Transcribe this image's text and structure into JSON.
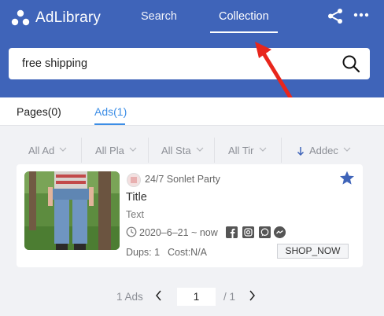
{
  "app": {
    "name": "AdLibrary"
  },
  "nav": {
    "search_label": "Search",
    "collection_label": "Collection"
  },
  "search": {
    "value": "free shipping",
    "placeholder": ""
  },
  "tabs": {
    "pages_label": "Pages(0)",
    "ads_label": "Ads(1)"
  },
  "filters": {
    "all_ad": "All Ad",
    "all_platforms": "All Pla",
    "all_status": "All Sta",
    "all_time": "All Tir",
    "sort": "Addec"
  },
  "card": {
    "page_name": "24/7 Sonlet Party",
    "title": "Title",
    "text": "Text",
    "date_range": "2020–6–21 ~ now",
    "dups": "Dups: 1",
    "cost": "Cost:N/A",
    "cta": "SHOP_NOW",
    "icons": [
      "facebook-icon",
      "instagram-icon",
      "messenger-square-icon",
      "messenger-icon"
    ]
  },
  "pager": {
    "count": "1 Ads",
    "page": "1",
    "total": "/ 1"
  },
  "colors": {
    "header": "#3f64b9",
    "accent": "#3d8ee6",
    "arrow": "#e8261c",
    "star": "#3f64b9"
  }
}
